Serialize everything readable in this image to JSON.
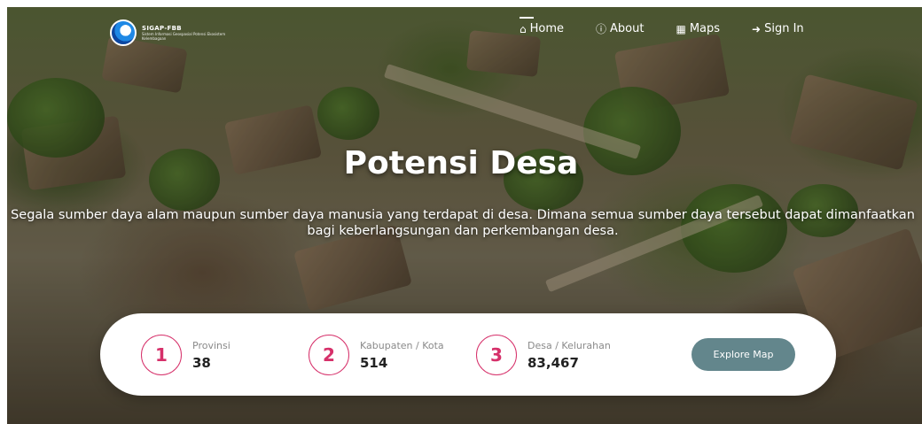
{
  "brand": {
    "name": "SIGAP-FBB",
    "subtitle": "Sistem Informasi Geospasial Potensi Ekosistem Kelembagaan"
  },
  "nav": {
    "items": [
      {
        "label": "Home",
        "icon": "home-icon"
      },
      {
        "label": "About",
        "icon": "info-icon"
      },
      {
        "label": "Maps",
        "icon": "map-icon"
      },
      {
        "label": "Sign In",
        "icon": "sign-in-icon"
      }
    ],
    "active": "Home"
  },
  "hero": {
    "title": "Potensi Desa",
    "description": "Segala sumber daya alam maupun sumber daya manusia yang terdapat di desa. Dimana semua sumber daya tersebut dapat dimanfaatkan bagi keberlangsungan dan perkembangan desa."
  },
  "stats": [
    {
      "number": "1",
      "label": "Provinsi",
      "value": "38"
    },
    {
      "number": "2",
      "label": "Kabupaten / Kota",
      "value": "514"
    },
    {
      "number": "3",
      "label": "Desa / Kelurahan",
      "value": "83,467"
    }
  ],
  "explore_label": "Explore Map",
  "colors": {
    "accent": "#d6306a",
    "button": "#63868c"
  }
}
